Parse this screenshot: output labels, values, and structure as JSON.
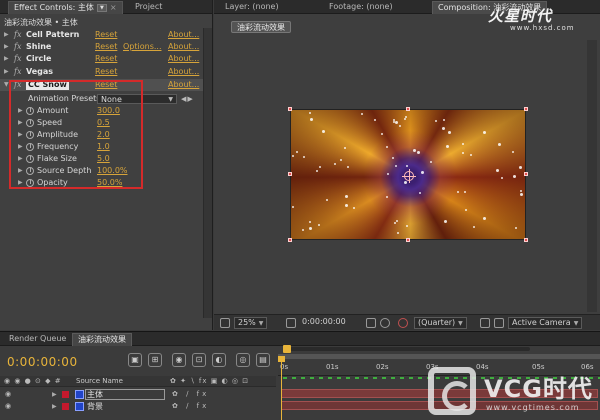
{
  "left_panel": {
    "tabs": [
      {
        "label": "Effect Controls: 主体"
      },
      {
        "label": "Project"
      }
    ],
    "header": "油彩流动效果 • 主体",
    "effects": [
      {
        "name": "Cell Pattern",
        "reset": "Reset",
        "options": "",
        "about": "About..."
      },
      {
        "name": "Shine",
        "reset": "Reset",
        "options": "Options...",
        "about": "About..."
      },
      {
        "name": "Circle",
        "reset": "Reset",
        "options": "",
        "about": "About..."
      },
      {
        "name": "Vegas",
        "reset": "Reset",
        "options": "",
        "about": "About..."
      },
      {
        "name": "CC Snow",
        "reset": "Reset",
        "options": "",
        "about": "About..."
      }
    ],
    "presets": {
      "label": "Animation Presets:",
      "value": "None"
    },
    "properties": [
      {
        "label": "Amount",
        "value": "300.0"
      },
      {
        "label": "Speed",
        "value": "0.5"
      },
      {
        "label": "Amplitude",
        "value": "2.0"
      },
      {
        "label": "Frequency",
        "value": "1.0"
      },
      {
        "label": "Flake Size",
        "value": "5.0"
      },
      {
        "label": "Source Depth",
        "value": "100.0%"
      },
      {
        "label": "Opacity",
        "value": "50.0%"
      }
    ]
  },
  "right_panel": {
    "tabs": [
      {
        "label": "Layer: (none)"
      },
      {
        "label": "Footage: (none)"
      },
      {
        "label": "Composition: 油彩流动效果"
      }
    ],
    "comp_button": "油彩流动效果",
    "toolbar": {
      "zoom": "25%",
      "timecode": "0:00:00:00",
      "resolution": "(Quarter)",
      "camera": "Active Camera"
    }
  },
  "watermark": {
    "text": "火星时代",
    "url": "www.hxsd.com"
  },
  "timeline": {
    "tabs": [
      {
        "label": "Render Queue"
      },
      {
        "label": "油彩流动效果"
      }
    ],
    "timecode": "0:00:00:00",
    "column_header": "Source Name",
    "layers": [
      {
        "name": "主体"
      },
      {
        "name": "背景"
      }
    ],
    "ruler": [
      "0s",
      "01s",
      "02s",
      "03s",
      "04s",
      "05s",
      "06s"
    ]
  },
  "vcg_watermark": {
    "text": "VCG时代",
    "url": "www.vcgtimes.com"
  },
  "colors": {
    "link": "#d7a43a",
    "highlight_box": "#d42a2a",
    "timecode": "#e8b43a",
    "layer_label": "#c4192d"
  }
}
